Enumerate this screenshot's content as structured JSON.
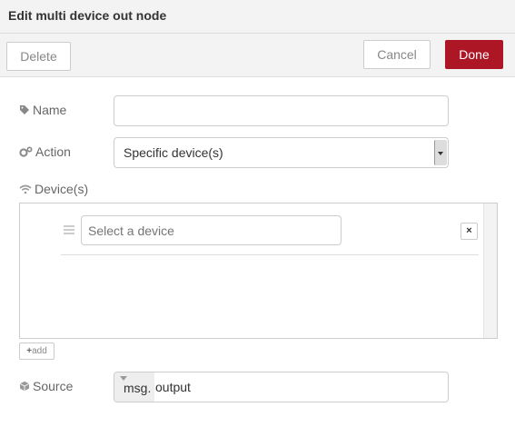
{
  "tray": {
    "title": "Edit multi device out node"
  },
  "toolbar": {
    "delete_label": "Delete",
    "cancel_label": "Cancel",
    "done_label": "Done"
  },
  "form": {
    "name": {
      "label": "Name",
      "value": ""
    },
    "action": {
      "label": "Action",
      "selected": "Specific device(s)"
    },
    "devices": {
      "label": "Device(s)",
      "items": [
        {
          "placeholder": "Select a device",
          "value": "",
          "remove_label": "×"
        }
      ],
      "add_label": "add"
    },
    "source": {
      "label": "Source",
      "type_label": "msg.",
      "value": "output"
    }
  },
  "colors": {
    "done_bg": "#ad1625",
    "panel_bg": "#ffffff",
    "chrome_bg": "#f3f3f3"
  }
}
